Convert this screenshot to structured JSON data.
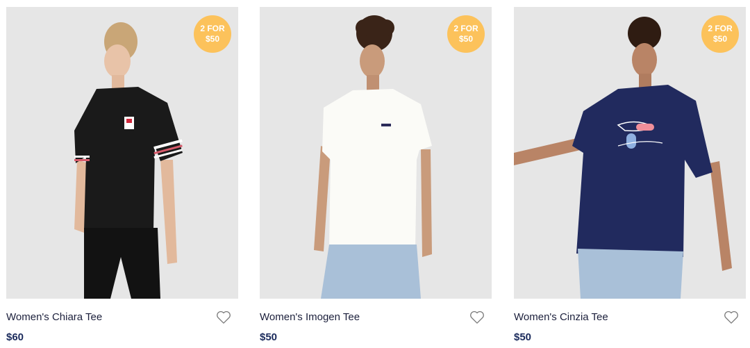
{
  "badge_color": "#fcc25b",
  "price_color": "#1b2b5c",
  "products": [
    {
      "name": "Women's Chiara Tee",
      "price": "$60",
      "badge": {
        "line1": "2 FOR",
        "line2": "$50"
      },
      "shirt_color": "#1a1a1a",
      "icon": "heart-icon"
    },
    {
      "name": "Women's Imogen Tee",
      "price": "$50",
      "badge": {
        "line1": "2 FOR",
        "line2": "$50"
      },
      "shirt_color": "#fbfbf7",
      "icon": "heart-icon"
    },
    {
      "name": "Women's Cinzia Tee",
      "price": "$50",
      "badge": {
        "line1": "2 FOR",
        "line2": "$50"
      },
      "shirt_color": "#212a5e",
      "icon": "heart-icon"
    }
  ]
}
